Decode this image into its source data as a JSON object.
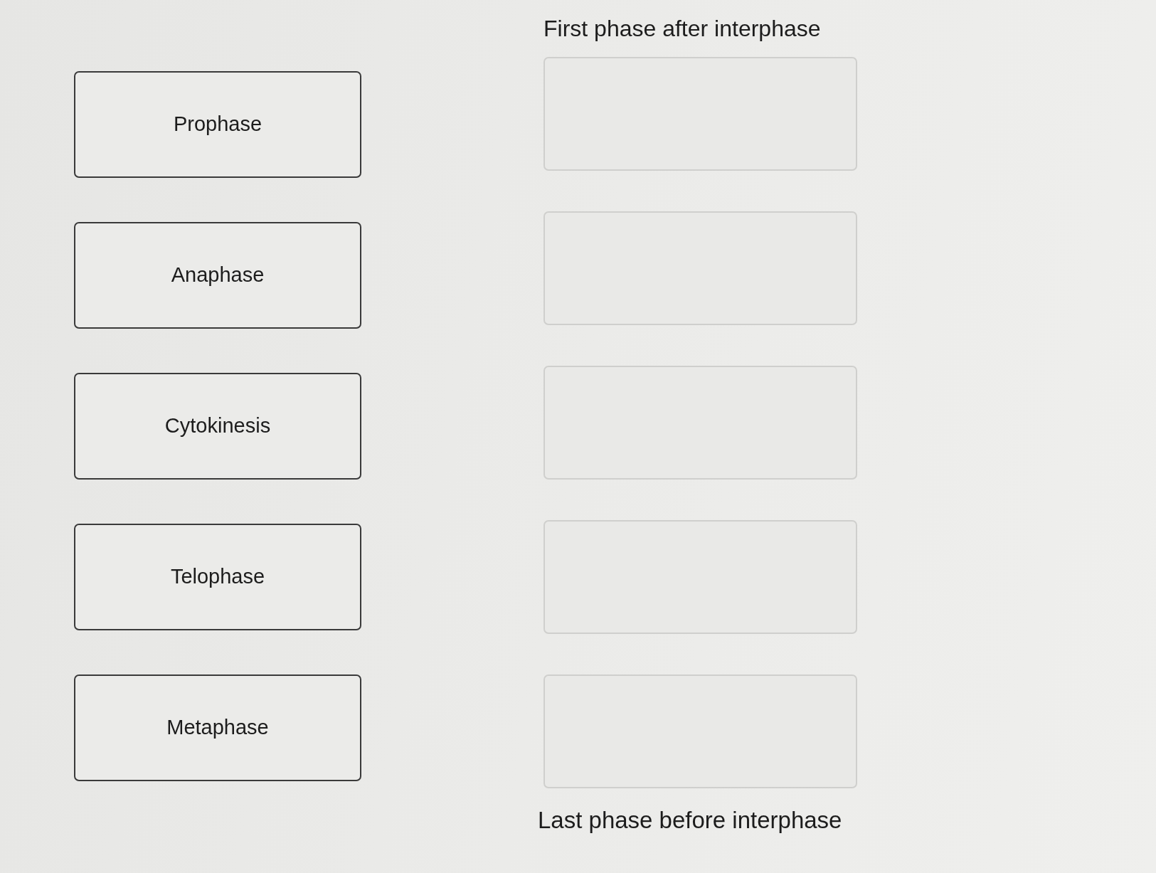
{
  "options": [
    {
      "label": "Prophase"
    },
    {
      "label": "Anaphase"
    },
    {
      "label": "Cytokinesis"
    },
    {
      "label": "Telophase"
    },
    {
      "label": "Metaphase"
    }
  ],
  "ordering": {
    "top_label": "First phase after interphase",
    "slots": [
      {
        "kind": "empty"
      },
      {
        "kind": "empty"
      },
      {
        "kind": "empty"
      },
      {
        "kind": "empty"
      },
      {
        "kind": "empty"
      }
    ],
    "bottom_label": "Last phase before interphase"
  }
}
